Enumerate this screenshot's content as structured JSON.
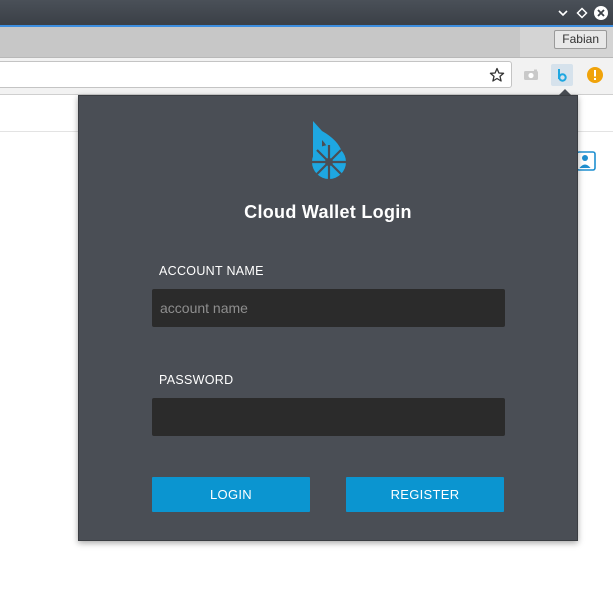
{
  "window": {
    "controls": [
      "minimize",
      "maximize",
      "close"
    ]
  },
  "tabstrip": {
    "profile_name": "Fabian"
  },
  "toolbar": {
    "icons": [
      "star-icon",
      "camera-extension-icon",
      "bitshares-extension-icon",
      "warning-extension-icon"
    ]
  },
  "popup": {
    "title": "Cloud Wallet Login",
    "account_label": "ACCOUNT NAME",
    "account_placeholder": "account name",
    "account_value": "",
    "password_label": "PASSWORD",
    "password_value": "",
    "login_label": "LOGIN",
    "register_label": "REGISTER"
  },
  "colors": {
    "accent": "#0b95d0",
    "popup_bg": "#4a4e55",
    "input_bg": "#2b2b2b",
    "warning": "#f0a30a",
    "logo_blue": "#1ea7e1"
  }
}
